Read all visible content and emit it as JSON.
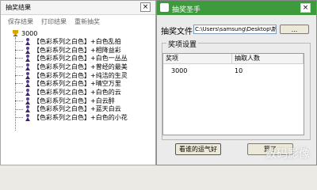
{
  "left_window": {
    "title": "抽奖结果",
    "close_glyph": "×",
    "menu": [
      "保存结果",
      "打印结果",
      "重新抽奖"
    ],
    "tree": {
      "root_label": "3000",
      "items": [
        "【色彩系列之白色】+白色乱拍",
        "【色彩系列之白色】+相降益彩",
        "【色彩系列之白色】+白色一丛丛",
        "【色彩系列之白色】+曾经的最美",
        "【色彩系列之白色】+纯洁的生灵",
        "【色彩系列之白色】+晴空万里",
        "【色彩系列之白色】+白色的云",
        "【色彩系列之白色】+白云醉",
        "【色彩系列之白色】+蓝天白云",
        "【色彩系列之白色】+白色的小花"
      ]
    }
  },
  "right_window": {
    "title": "抽奖圣手",
    "close_glyph": "×",
    "file_label": "抽奖文件",
    "file_path": "C:\\Users\\samsung\\Desktop\\新建",
    "browse_label": "...",
    "group_title": "奖项设置",
    "table": {
      "headers": [
        "奖项",
        "抽取人数"
      ],
      "rows": [
        [
          "3000",
          "10"
        ]
      ]
    },
    "luck_button": "看谁的运气好",
    "quit_button": "算了"
  },
  "watermark": "数码影像",
  "colors": {
    "titlebar_green": "#3d9b3d",
    "window_bg": "#ebebeb",
    "accent_purple": "#5a3d8a",
    "trophy_gold": "#d9a300"
  },
  "icons": {
    "tree_root": "trophy-icon",
    "tree_item": "person-figure-icon",
    "app": "app-icon"
  }
}
